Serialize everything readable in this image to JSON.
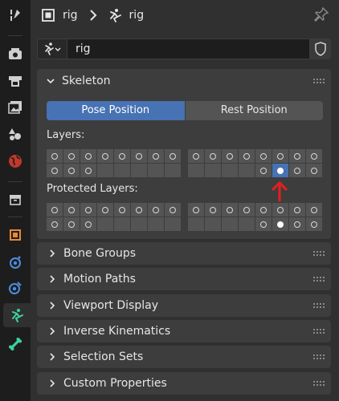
{
  "header": {
    "object_name": "rig",
    "data_name": "rig"
  },
  "object_selector": {
    "value": "rig"
  },
  "skeleton": {
    "title": "Skeleton",
    "pose_label": "Pose Position",
    "rest_label": "Rest Position",
    "selected_mode": "Pose Position",
    "layers_label": "Layers:",
    "protected_label": "Protected Layers:",
    "layers": {
      "left_top": [
        "o",
        "o",
        "o",
        "o",
        "o",
        "o",
        "o",
        "o"
      ],
      "left_bottom": [
        "o",
        "o",
        "o",
        "",
        "",
        "",
        "",
        ""
      ],
      "right_top": [
        "o",
        "o",
        "o",
        "o",
        "o",
        "o",
        "o",
        "o"
      ],
      "right_bottom": [
        "",
        "",
        "",
        "",
        "o",
        "selected",
        "o",
        "o"
      ]
    },
    "protected_layers": {
      "left_top": [
        "o",
        "o",
        "o",
        "o",
        "o",
        "o",
        "o",
        "o"
      ],
      "left_bottom": [
        "o",
        "o",
        "o",
        "",
        "",
        "",
        "",
        ""
      ],
      "right_top": [
        "o",
        "o",
        "o",
        "o",
        "o",
        "o",
        "o",
        "o"
      ],
      "right_bottom": [
        "",
        "",
        "",
        "",
        "o",
        "filled",
        "o",
        "o"
      ]
    }
  },
  "panels": [
    "Bone Groups",
    "Motion Paths",
    "Viewport Display",
    "Inverse Kinematics",
    "Selection Sets",
    "Custom Properties"
  ],
  "colors": {
    "accent": "#4772b3",
    "annotation": "#e02020",
    "armature_tab": "#3ad3a0"
  },
  "icons": [
    "tool-icon",
    "render-icon",
    "output-icon",
    "view-layer-icon",
    "scene-icon",
    "world-icon",
    "collection-icon",
    "object-icon",
    "physics-icon",
    "constraints-icon",
    "armature-data-icon",
    "bone-icon"
  ]
}
